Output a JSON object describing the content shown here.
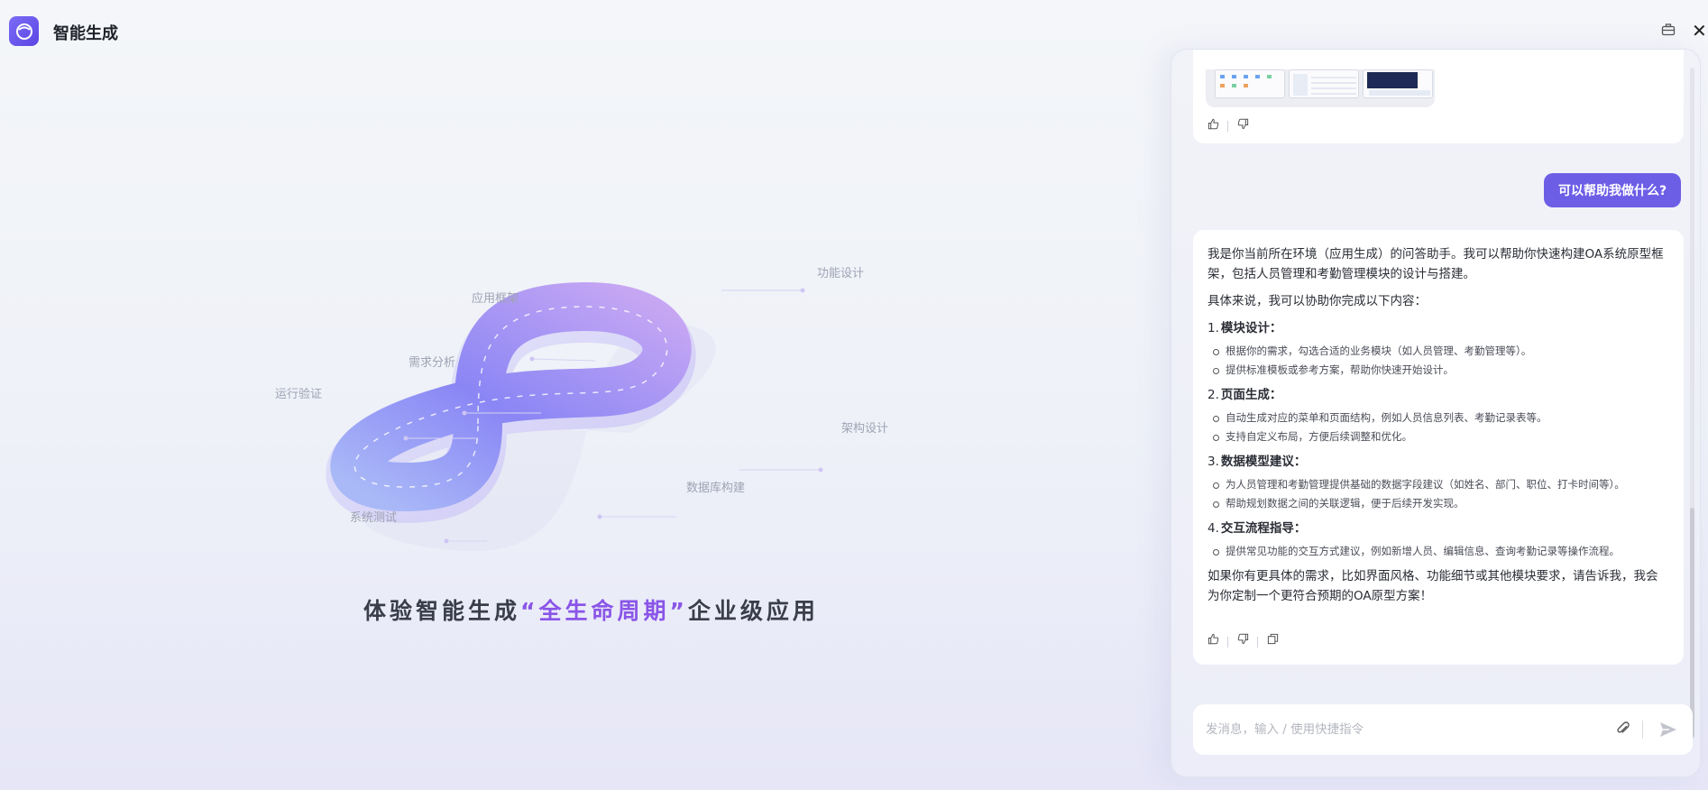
{
  "app": {
    "title": "智能生成"
  },
  "hero": {
    "labels": {
      "app_framework": "应用框架",
      "feature_design": "功能设计",
      "requirement_analysis": "需求分析",
      "run_validation": "运行验证",
      "architecture_design": "架构设计",
      "database_build": "数据库构建",
      "system_test": "系统测试"
    },
    "title_prefix": "体验智能生成",
    "title_highlight": "“全生命周期”",
    "title_suffix": "企业级应用"
  },
  "chat": {
    "user_message": "可以帮助我做什么?",
    "answer": {
      "intro": "我是你当前所在环境（应用生成）的问答助手。我可以帮助你快速构建OA系统原型框架，包括人员管理和考勤管理模块的设计与搭建。",
      "lead": "具体来说，我可以协助你完成以下内容：",
      "sections": [
        {
          "num": "1.",
          "title": "模块设计：",
          "items": [
            "根据你的需求，勾选合适的业务模块（如人员管理、考勤管理等）。",
            "提供标准模板或参考方案，帮助你快速开始设计。"
          ]
        },
        {
          "num": "2.",
          "title": "页面生成：",
          "items": [
            "自动生成对应的菜单和页面结构，例如人员信息列表、考勤记录表等。",
            "支持自定义布局，方便后续调整和优化。"
          ]
        },
        {
          "num": "3.",
          "title": "数据模型建议：",
          "items": [
            "为人员管理和考勤管理提供基础的数据字段建议（如姓名、部门、职位、打卡时间等）。",
            "帮助规划数据之间的关联逻辑，便于后续开发实现。"
          ]
        },
        {
          "num": "4.",
          "title": "交互流程指导：",
          "items": [
            "提供常见功能的交互方式建议，例如新增人员、编辑信息、查询考勤记录等操作流程。"
          ]
        }
      ],
      "outro": "如果你有更具体的需求，比如界面风格、功能细节或其他模块要求，请告诉我，我会为你定制一个更符合预期的OA原型方案！"
    },
    "input": {
      "placeholder": "发消息，输入 / 使用快捷指令",
      "value": ""
    }
  },
  "colors": {
    "accent": "#6d5ee6",
    "highlight": "#8a55e8"
  }
}
